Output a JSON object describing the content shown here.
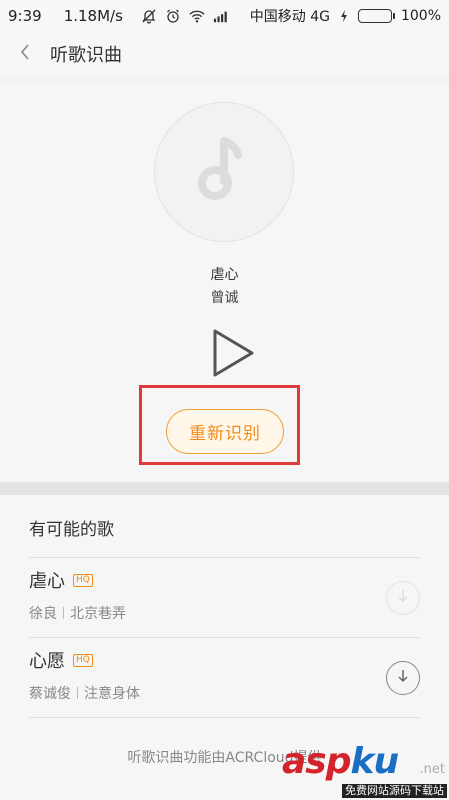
{
  "status_bar": {
    "time": "9:39",
    "speed": "1.18M/s",
    "carrier": "中国移动 4G",
    "battery_text": "100%",
    "battery_level": 100,
    "battery_color": "#3cc03c"
  },
  "header": {
    "title": "听歌识曲"
  },
  "recognition": {
    "song_title": "虐心",
    "artist": "曾诚",
    "retry_label": "重新识别",
    "accent_color": "#f08a1a",
    "highlight_color": "#e03a3a"
  },
  "results": {
    "header": "有可能的歌",
    "items": [
      {
        "name": "虐心",
        "badge": "HQ",
        "artist": "徐良",
        "album": "北京巷弄",
        "download_enabled": false
      },
      {
        "name": "心愿",
        "badge": "HQ",
        "artist": "蔡诚俊",
        "album": "注意身体",
        "download_enabled": true
      }
    ]
  },
  "footer": {
    "credit": "听歌识曲功能由ACRCloud提供"
  },
  "watermark": {
    "brand_asp": "asp",
    "brand_ku": "ku",
    "net": ".net",
    "sub": "免费网站源码下载站"
  }
}
